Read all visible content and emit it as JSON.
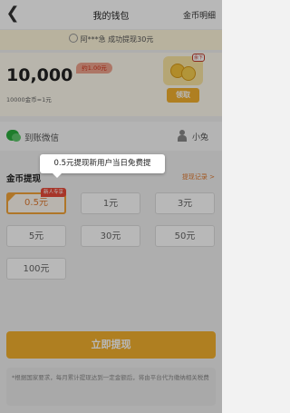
{
  "header": {
    "back_icon": "back-arrow-icon",
    "title": "我的钱包",
    "detail_link": "金币明细"
  },
  "notice": {
    "text": "阿***急 成功提现30元"
  },
  "balance": {
    "coins": "10,000",
    "yuan_badge": "约1.00元",
    "rate": "10000金币=1元",
    "redeem_label": "领取",
    "redeem_tag": "余下"
  },
  "payout": {
    "method_label": "到账微信",
    "user_name": "小兔"
  },
  "tooltip": {
    "text": "0.5元提现新用户当日免费提"
  },
  "withdraw": {
    "section_title": "金币提现",
    "record_link": "提现记录 >",
    "new_user_tag": "新人专享",
    "options": [
      "0.5元",
      "1元",
      "3元",
      "5元",
      "30元",
      "50元",
      "100元"
    ],
    "selected_index": 0
  },
  "submit_label": "立即提现",
  "footnote": "*根据国家要求，每月累计提现达到一定金额后，将由平台代为缴纳相关税费"
}
